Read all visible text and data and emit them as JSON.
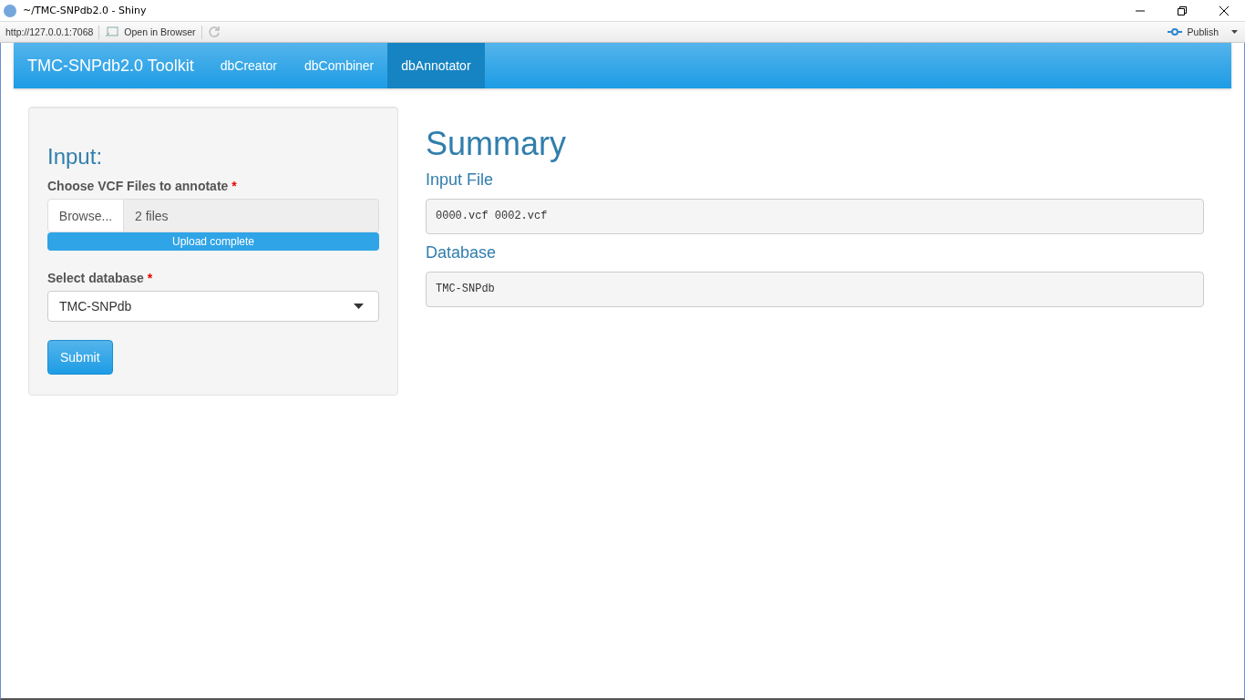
{
  "window": {
    "title": "~/TMC-SNPdb2.0 - Shiny"
  },
  "toolbar": {
    "url": "http://127.0.0.1:7068",
    "open_in_browser": "Open in Browser",
    "publish": "Publish"
  },
  "navbar": {
    "brand": "TMC-SNPdb2.0 Toolkit",
    "tabs": [
      {
        "label": "dbCreator",
        "selected": false
      },
      {
        "label": "dbCombiner",
        "selected": false
      },
      {
        "label": "dbAnnotator",
        "selected": true
      }
    ]
  },
  "sidebar": {
    "heading": "Input:",
    "file_input": {
      "label": "Choose VCF Files to annotate",
      "required": "*",
      "button": "Browse...",
      "value": "2 files",
      "progress": {
        "level": 1,
        "text": "Upload complete"
      }
    },
    "select": {
      "label": "Select database",
      "required": "*",
      "value": "TMC-SNPdb"
    },
    "submit": "Submit"
  },
  "main": {
    "heading": "Summary",
    "sections": [
      {
        "title": "Input File",
        "output": "0000.vcf 0002.vcf"
      },
      {
        "title": "Database",
        "output": "TMC-SNPdb"
      }
    ]
  }
}
